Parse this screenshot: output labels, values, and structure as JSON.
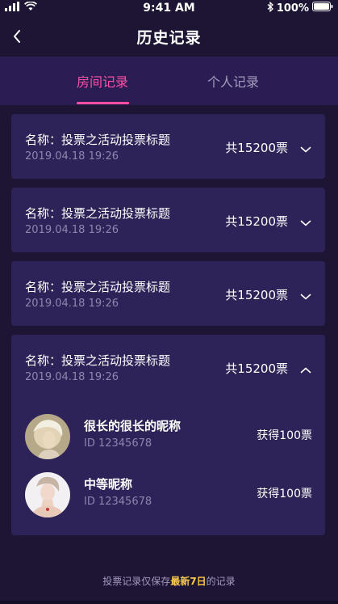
{
  "status_bar": {
    "time": "9:41 AM",
    "battery": "100%"
  },
  "nav": {
    "title": "历史记录"
  },
  "tabs": [
    {
      "label": "房间记录",
      "active": true
    },
    {
      "label": "个人记录",
      "active": false
    }
  ],
  "records": [
    {
      "name": "名称：投票之活动投票标题",
      "date": "2019.04.18 19:26",
      "total": "共15200票",
      "expanded": false
    },
    {
      "name": "名称：投票之活动投票标题",
      "date": "2019.04.18 19:26",
      "total": "共15200票",
      "expanded": false
    },
    {
      "name": "名称：投票之活动投票标题",
      "date": "2019.04.18 19:26",
      "total": "共15200票",
      "expanded": false
    },
    {
      "name": "名称：投票之活动投票标题",
      "date": "2019.04.18 19:26",
      "total": "共15200票",
      "expanded": true,
      "members": [
        {
          "nickname": "很长的很长的昵称",
          "id": "ID 12345678",
          "votes": "获得100票"
        },
        {
          "nickname": "中等昵称",
          "id": "ID 12345678",
          "votes": "获得100票"
        }
      ]
    }
  ],
  "footer": {
    "prefix": "投票记录仅保存",
    "highlight": "最新7日",
    "suffix": "的记录"
  },
  "colors": {
    "background": "#1e1535",
    "card": "#2e2358",
    "accent": "#ff4fa3",
    "highlight": "#ffc94a"
  },
  "icons": [
    "signal-icon",
    "wifi-icon",
    "bluetooth-icon",
    "battery-icon",
    "back-arrow-icon",
    "chevron-down-icon",
    "chevron-up-icon"
  ]
}
